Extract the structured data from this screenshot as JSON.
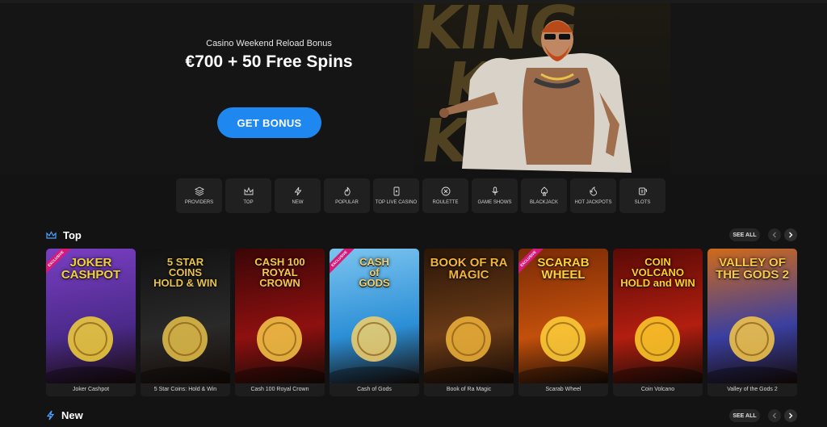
{
  "hero": {
    "subtitle": "Casino Weekend Reload Bonus",
    "title": "€700 + 50 Free Spins",
    "button": "GET BONUS",
    "art_text": "KING"
  },
  "categories": [
    {
      "label": "PROVIDERS",
      "icon": "layers-icon"
    },
    {
      "label": "TOP",
      "icon": "crown-icon"
    },
    {
      "label": "NEW",
      "icon": "lightning-icon"
    },
    {
      "label": "POPULAR",
      "icon": "flame-icon"
    },
    {
      "label": "TOP LIVE CASINO",
      "icon": "card-icon"
    },
    {
      "label": "ROULETTE",
      "icon": "roulette-icon"
    },
    {
      "label": "GAME SHOWS",
      "icon": "microphone-icon"
    },
    {
      "label": "BLACKJACK",
      "icon": "spade-icon"
    },
    {
      "label": "HOT JACKPOTS",
      "icon": "fire-icon"
    },
    {
      "label": "SLOTS",
      "icon": "slot-icon"
    }
  ],
  "sections": {
    "top": {
      "title": "Top",
      "see_all": "SEE ALL"
    },
    "new": {
      "title": "New",
      "see_all": "SEE ALL"
    }
  },
  "games": [
    {
      "name": "Joker Cashpot",
      "art": "JOKER\nCASHPOT",
      "badge": "EXCLUSIVE",
      "bg": "#4b2a8a",
      "bg2": "#7a3ec2",
      "accent": "#f3d23a"
    },
    {
      "name": "5 Star Coins: Hold & Win",
      "art": "5 STAR\nCOINS\nHOLD & WIN",
      "badge": "",
      "bg": "#2a2a2a",
      "bg2": "#111111",
      "accent": "#e8c24a"
    },
    {
      "name": "Cash 100 Royal Crown",
      "art": "CASH 100\nROYAL\nCROWN",
      "badge": "",
      "bg": "#8e1010",
      "bg2": "#3a0606",
      "accent": "#f7c948"
    },
    {
      "name": "Cash of Gods",
      "art": "CASH\nof\nGODS",
      "badge": "EXCLUSIVE",
      "bg": "#2b8fd6",
      "bg2": "#7cc4ef",
      "accent": "#f4d06a"
    },
    {
      "name": "Book of Ra Magic",
      "art": "BOOK OF RA\nMAGIC",
      "badge": "",
      "bg": "#6a3a16",
      "bg2": "#2a1608",
      "accent": "#f0b43a"
    },
    {
      "name": "Scarab Wheel",
      "art": "SCARAB\nWHEEL",
      "badge": "EXCLUSIVE",
      "bg": "#c2500c",
      "bg2": "#7a2a06",
      "accent": "#ffd13a"
    },
    {
      "name": "Coin Volcano",
      "art": "COIN\nVOLCANO\nHOLD and WIN",
      "badge": "",
      "bg": "#b21e10",
      "bg2": "#5a0a06",
      "accent": "#ffcf2a"
    },
    {
      "name": "Valley of the Gods 2",
      "art": "VALLEY OF THE GODS 2",
      "badge": "",
      "bg": "#3a3fa0",
      "bg2": "#d06a1a",
      "accent": "#f7c948"
    }
  ]
}
